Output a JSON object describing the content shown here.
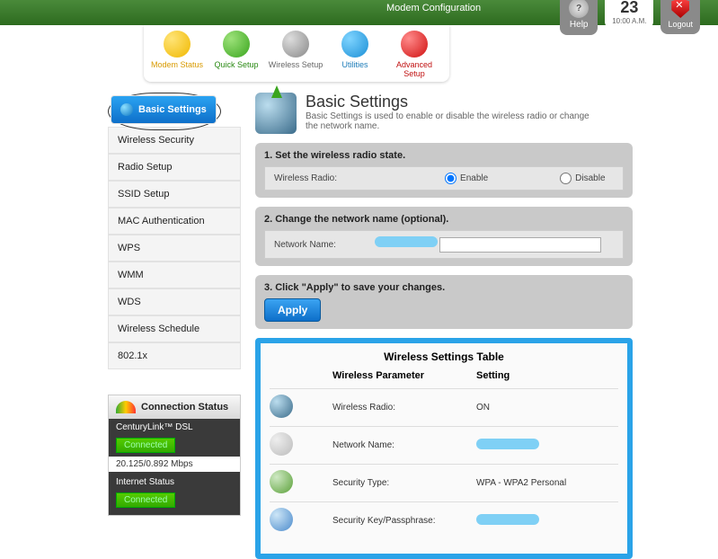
{
  "header": {
    "subtitle": "Modem Configuration",
    "help": "Help",
    "date_day": "23",
    "date_time": "10:00 A.M.",
    "logout": "Logout"
  },
  "topnav": {
    "items": [
      {
        "label": "Modem Status"
      },
      {
        "label": "Quick Setup"
      },
      {
        "label": "Wireless Setup"
      },
      {
        "label": "Utilities"
      },
      {
        "label": "Advanced Setup"
      }
    ]
  },
  "sidebar": {
    "items": [
      "Basic Settings",
      "Wireless Security",
      "Radio Setup",
      "SSID Setup",
      "MAC Authentication",
      "WPS",
      "WMM",
      "WDS",
      "Wireless Schedule",
      "802.1x"
    ]
  },
  "status": {
    "title": "Connection Status",
    "line1": "CenturyLink™ DSL",
    "connected": "Connected",
    "speed": "20.125/0.892 Mbps",
    "line2": "Internet Status"
  },
  "page": {
    "title": "Basic Settings",
    "desc": "Basic Settings is used to enable or disable the wireless radio or change the network name."
  },
  "step1": {
    "title": "1. Set the wireless radio state.",
    "label": "Wireless Radio:",
    "opt_enable": "Enable",
    "opt_disable": "Disable"
  },
  "step2": {
    "title": "2. Change the network name (optional).",
    "label": "Network Name:"
  },
  "step3": {
    "title": "3. Click \"Apply\" to save your changes.",
    "apply": "Apply"
  },
  "table": {
    "title": "Wireless Settings Table",
    "col1": "Wireless Parameter",
    "col2": "Setting",
    "rows": [
      {
        "param": "Wireless Radio:",
        "val": "ON"
      },
      {
        "param": "Network Name:",
        "val": ""
      },
      {
        "param": "Security Type:",
        "val": "WPA - WPA2 Personal"
      },
      {
        "param": "Security Key/Passphrase:",
        "val": ""
      }
    ]
  }
}
